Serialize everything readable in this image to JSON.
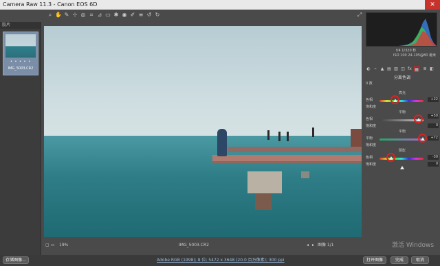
{
  "window": {
    "title": "Camera Raw 11.3 - Canon EOS 6D",
    "close": "✕"
  },
  "filmstrip": {
    "header": "胶片",
    "thumb_name": "IMG_5003.CR2",
    "stars": "• • • • •"
  },
  "preview": {
    "filename": "IMG_5003.CR2",
    "zoom": "19%",
    "page": "图像 1/1"
  },
  "right_panel": {
    "camera_info": [
      "f/4  1/320 秒",
      "ISO 100  24-105@80 毫米"
    ],
    "section": "分离色调",
    "dropdown": "0 数",
    "highlights": {
      "label": "高光",
      "hue_label": "色相",
      "hue": "+22",
      "sat_label": "饱和度",
      "sat": "0"
    },
    "midtones_saturation": {
      "label": "平衡",
      "value": "+50"
    },
    "balance": {
      "label": "平衡",
      "value": "+72"
    },
    "shadows": {
      "label": "阴影",
      "hue_label": "色相",
      "hue": "-30",
      "sat_label": "饱和度",
      "sat": "0"
    }
  },
  "statusbar": {
    "save_button": "存储图像...",
    "info_link": "Adobe RGB (1998); 8 位; 5472 x 3648 (20.0 百万像素); 300 ppi",
    "open_button": "打开图像",
    "done_button": "完成",
    "cancel_button": "取消"
  },
  "watermark": "激活 Windows"
}
